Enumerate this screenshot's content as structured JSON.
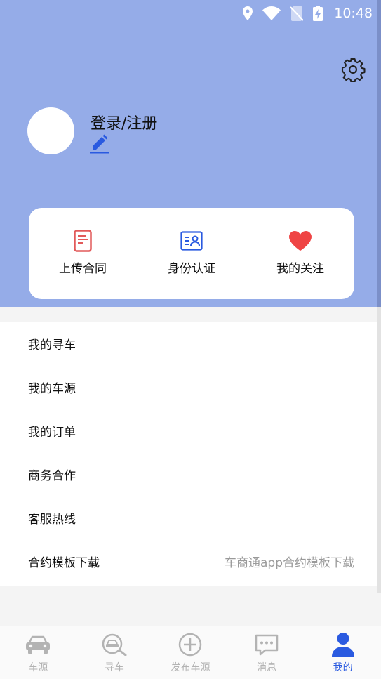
{
  "status_bar": {
    "time": "10:48"
  },
  "profile": {
    "login_label": "登录/注册"
  },
  "quick_actions": [
    {
      "label": "上传合同",
      "icon": "contract-icon"
    },
    {
      "label": "身份认证",
      "icon": "id-card-icon"
    },
    {
      "label": "我的关注",
      "icon": "heart-icon"
    }
  ],
  "menu": [
    {
      "label": "我的寻车",
      "hint": ""
    },
    {
      "label": "我的车源",
      "hint": ""
    },
    {
      "label": "我的订单",
      "hint": ""
    },
    {
      "label": "商务合作",
      "hint": ""
    },
    {
      "label": "客服热线",
      "hint": ""
    },
    {
      "label": "合约模板下载",
      "hint": "车商通app合约模板下载"
    }
  ],
  "bottom_nav": [
    {
      "label": "车源",
      "icon": "car-icon",
      "active": false
    },
    {
      "label": "寻车",
      "icon": "car-search-icon",
      "active": false
    },
    {
      "label": "发布车源",
      "icon": "plus-circle-icon",
      "active": false
    },
    {
      "label": "消息",
      "icon": "message-icon",
      "active": false
    },
    {
      "label": "我的",
      "icon": "user-icon",
      "active": true
    }
  ],
  "colors": {
    "header_bg": "#95ace8",
    "accent": "#2a5ae0",
    "contract_red": "#e25a5a",
    "heart_red": "#ef4444",
    "id_blue": "#2a5ae0",
    "inactive_gray": "#b3b3b3"
  }
}
